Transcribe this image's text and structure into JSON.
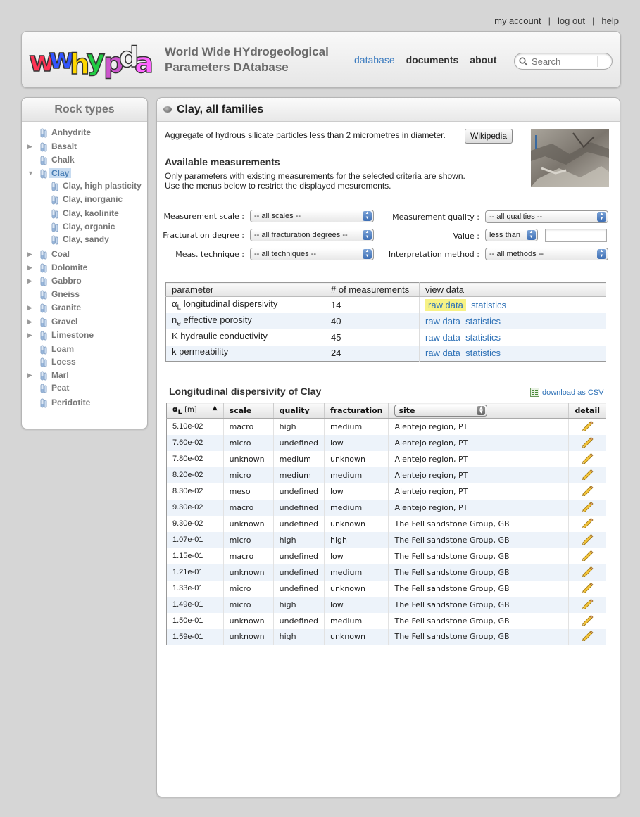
{
  "toplinks": {
    "account": "my account",
    "logout": "log out",
    "help": "help",
    "sep": "|"
  },
  "header": {
    "title_line1": "World Wide HYdrogeological",
    "title_line2": "Parameters DAtabase",
    "nav": [
      "database",
      "documents",
      "about"
    ],
    "search_placeholder": "Search"
  },
  "sidebar": {
    "title": "Rock types",
    "items": [
      {
        "label": "Anhydrite",
        "arrow": ""
      },
      {
        "label": "Basalt",
        "arrow": "▶"
      },
      {
        "label": "Chalk",
        "arrow": ""
      },
      {
        "label": "Clay",
        "arrow": "▼"
      },
      {
        "label": "Clay, high plasticity",
        "arrow": ""
      },
      {
        "label": "Clay, inorganic",
        "arrow": ""
      },
      {
        "label": "Clay, kaolinite",
        "arrow": ""
      },
      {
        "label": "Clay, organic",
        "arrow": ""
      },
      {
        "label": "Clay, sandy",
        "arrow": ""
      },
      {
        "label": "Coal",
        "arrow": "▶"
      },
      {
        "label": "Dolomite",
        "arrow": "▶"
      },
      {
        "label": "Gabbro",
        "arrow": "▶"
      },
      {
        "label": "Gneiss",
        "arrow": ""
      },
      {
        "label": "Granite",
        "arrow": "▶"
      },
      {
        "label": "Gravel",
        "arrow": "▶"
      },
      {
        "label": "Limestone",
        "arrow": "▶"
      },
      {
        "label": "Loam",
        "arrow": ""
      },
      {
        "label": "Loess",
        "arrow": ""
      },
      {
        "label": "Marl",
        "arrow": "▶"
      },
      {
        "label": "Peat",
        "arrow": ""
      },
      {
        "label": "Peridotite",
        "arrow": ""
      }
    ]
  },
  "main": {
    "title": "Clay, all families",
    "description": "Aggregate of hydrous silicate particles less than 2 micrometres in diameter.",
    "wiki_button": "Wikipedia",
    "avail_title": "Available measurements",
    "avail_line1": "Only parameters with existing measurements for the selected criteria are shown.",
    "avail_line2": "Use the menus below to restrict the displayed mesurements.",
    "filters": {
      "scale_label": "Measurement scale :",
      "scale_value": "-- all scales --",
      "frac_label": "Fracturation degree :",
      "frac_value": "-- all fracturation degrees --",
      "tech_label": "Meas. technique :",
      "tech_value": "-- all techniques --",
      "quality_label": "Measurement quality :",
      "quality_value": "-- all qualities --",
      "value_label": "Value :",
      "value_op": "less than",
      "interp_label": "Interpretation method :",
      "interp_value": "-- all methods --"
    },
    "param_table": {
      "headers": [
        "parameter",
        "# of measurements",
        "view data"
      ],
      "rows": [
        {
          "sym": "α",
          "sub": "L",
          "name": "longitudinal dispersivity",
          "count": "14",
          "raw": "raw data",
          "stats": "statistics"
        },
        {
          "sym": "n",
          "sub": "e",
          "name": "effective porosity",
          "count": "40",
          "raw": "raw data",
          "stats": "statistics"
        },
        {
          "sym": "K",
          "sub": "",
          "name": "hydraulic conductivity",
          "count": "45",
          "raw": "raw data",
          "stats": "statistics"
        },
        {
          "sym": "k",
          "sub": "",
          "name": "permeability",
          "count": "24",
          "raw": "raw data",
          "stats": "statistics"
        }
      ]
    },
    "disp_title": "Longitudinal dispersivity of Clay",
    "csv_label": "download as CSV",
    "data_table": {
      "col_sym": "α",
      "col_sub": "L",
      "col_unit": "[m]",
      "col_sort": "▲",
      "headers": [
        "scale",
        "quality",
        "fracturation",
        "site",
        "detail"
      ],
      "rows": [
        {
          "v": "5.10e-02",
          "scale": "macro",
          "quality": "high",
          "frac": "medium",
          "site": "Alentejo region, PT"
        },
        {
          "v": "7.60e-02",
          "scale": "micro",
          "quality": "undefined",
          "frac": "low",
          "site": "Alentejo region, PT"
        },
        {
          "v": "7.80e-02",
          "scale": "unknown",
          "quality": "medium",
          "frac": "unknown",
          "site": "Alentejo region, PT"
        },
        {
          "v": "8.20e-02",
          "scale": "micro",
          "quality": "medium",
          "frac": "medium",
          "site": "Alentejo region, PT"
        },
        {
          "v": "8.30e-02",
          "scale": "meso",
          "quality": "undefined",
          "frac": "low",
          "site": "Alentejo region, PT"
        },
        {
          "v": "9.30e-02",
          "scale": "macro",
          "quality": "undefined",
          "frac": "medium",
          "site": "Alentejo region, PT"
        },
        {
          "v": "9.30e-02",
          "scale": "unknown",
          "quality": "undefined",
          "frac": "unknown",
          "site": "The Fell sandstone Group, GB"
        },
        {
          "v": "1.07e-01",
          "scale": "micro",
          "quality": "high",
          "frac": "high",
          "site": "The Fell sandstone Group, GB"
        },
        {
          "v": "1.15e-01",
          "scale": "macro",
          "quality": "undefined",
          "frac": "low",
          "site": "The Fell sandstone Group, GB"
        },
        {
          "v": "1.21e-01",
          "scale": "unknown",
          "quality": "undefined",
          "frac": "medium",
          "site": "The Fell sandstone Group, GB"
        },
        {
          "v": "1.33e-01",
          "scale": "micro",
          "quality": "undefined",
          "frac": "unknown",
          "site": "The Fell sandstone Group, GB"
        },
        {
          "v": "1.49e-01",
          "scale": "micro",
          "quality": "high",
          "frac": "low",
          "site": "The Fell sandstone Group, GB"
        },
        {
          "v": "1.50e-01",
          "scale": "unknown",
          "quality": "undefined",
          "frac": "medium",
          "site": "The Fell sandstone Group, GB"
        },
        {
          "v": "1.59e-01",
          "scale": "unknown",
          "quality": "high",
          "frac": "unknown",
          "site": "The Fell sandstone Group, GB"
        }
      ]
    }
  },
  "colors": {
    "link": "#2f72b7",
    "highlight": "#f7f285",
    "alt_row": "#edf3fa",
    "selected": "#c8dcf1"
  }
}
